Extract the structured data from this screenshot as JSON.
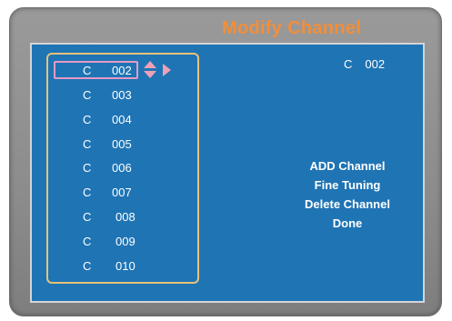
{
  "title": "Modify Channel",
  "current_channel": {
    "prefix": "C",
    "number": "002"
  },
  "channels": [
    {
      "prefix": "C",
      "number": "002",
      "selected": true
    },
    {
      "prefix": "C",
      "number": "003"
    },
    {
      "prefix": "C",
      "number": "004"
    },
    {
      "prefix": "C",
      "number": "005"
    },
    {
      "prefix": "C",
      "number": "006"
    },
    {
      "prefix": "C",
      "number": "007"
    },
    {
      "prefix": "C",
      "number": "008"
    },
    {
      "prefix": "C",
      "number": "009"
    },
    {
      "prefix": "C",
      "number": "010"
    }
  ],
  "menu": {
    "items": [
      "ADD Channel",
      "Fine Tuning",
      "Delete Channel",
      "Done"
    ]
  },
  "colors": {
    "title": "#f08f3c",
    "panel": "#1f74b4",
    "list_border": "#e8c27a",
    "selection": "#e59ac6",
    "arrows": "#eea0b8"
  },
  "icons": [
    "up-down-arrow-icon",
    "right-arrow-icon"
  ]
}
